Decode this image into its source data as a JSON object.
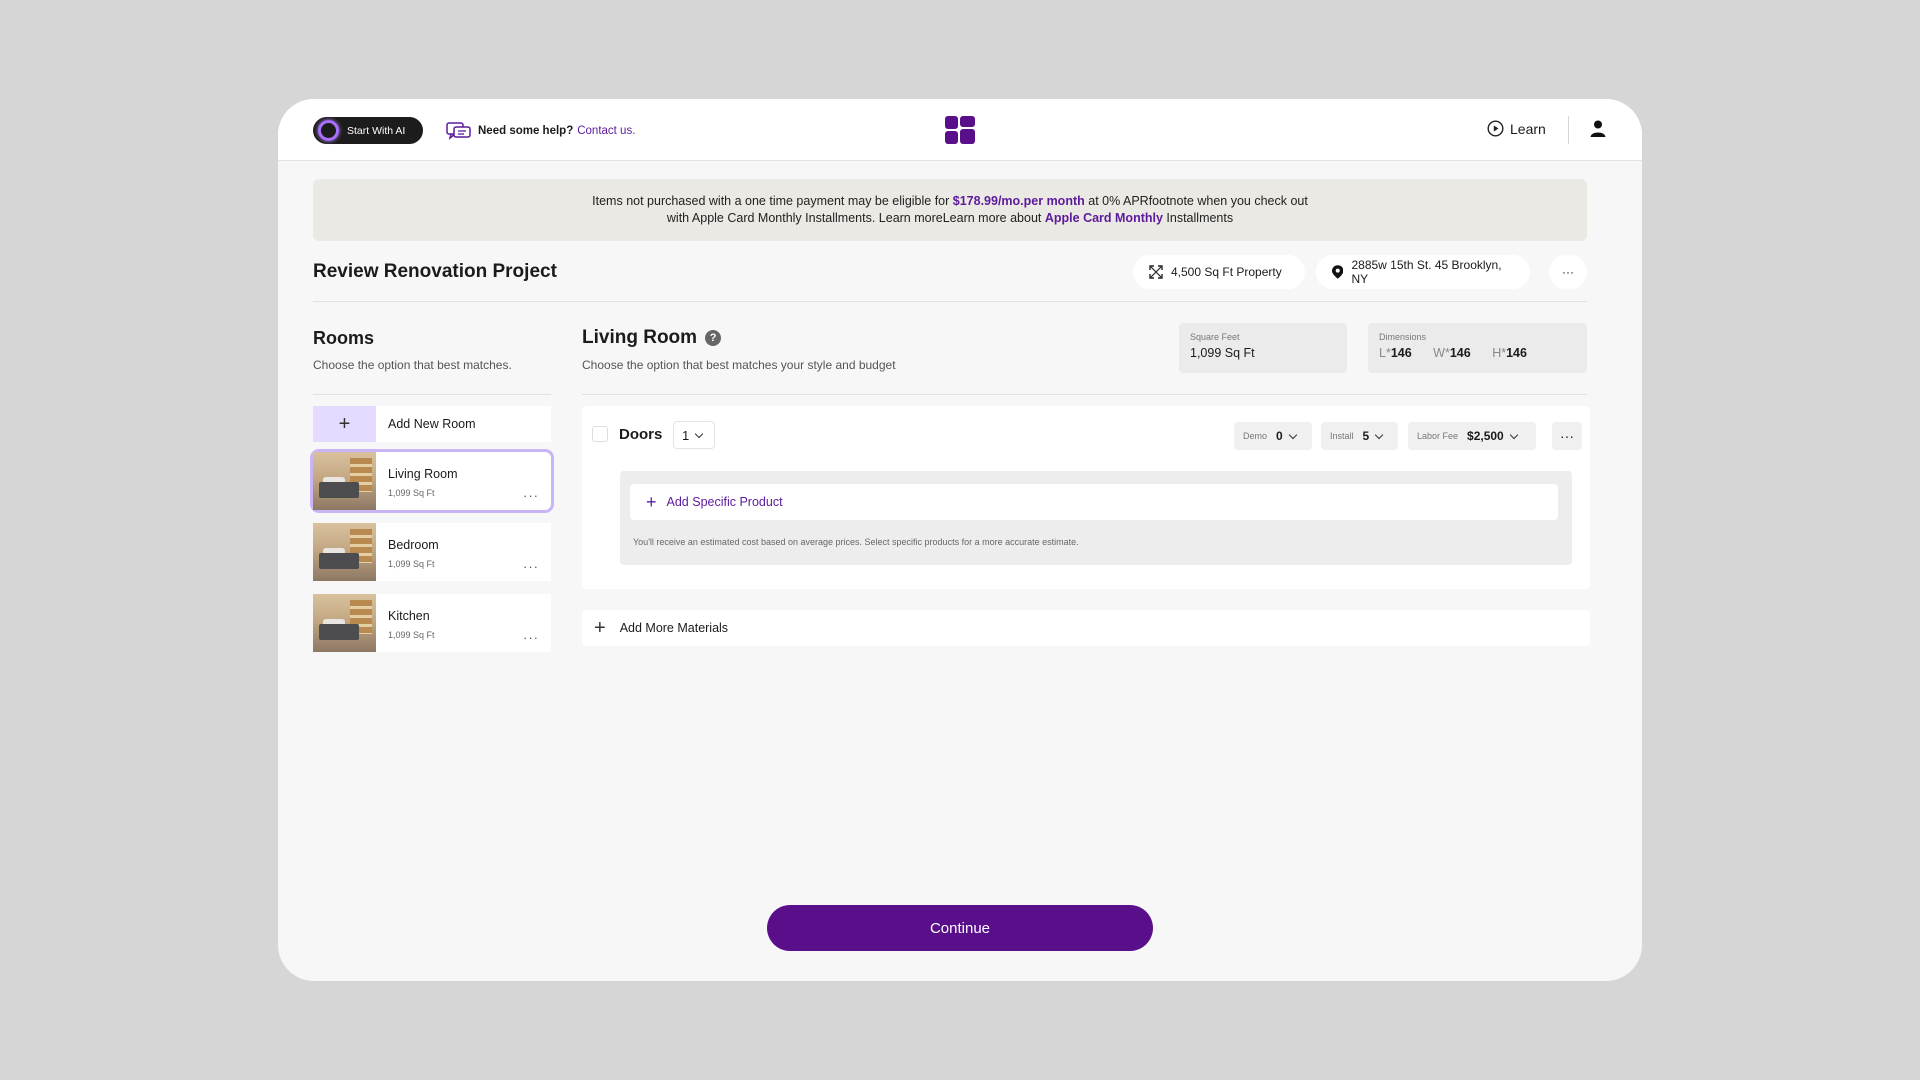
{
  "topbar": {
    "ai_button": "Start With AI",
    "help_text": "Need some help?",
    "help_link": "Contact us.",
    "learn": "Learn"
  },
  "banner": {
    "pre": "Items not purchased with a one time payment may be eligible for ",
    "price": "$178.99/mo.per month",
    "mid": " at 0% APRfootnote when you check out",
    "line2_pre": "with Apple Card Monthly Installments. Learn moreLearn more about ",
    "line2_bold": "Apple Card Monthly",
    "line2_post": " Installments"
  },
  "project": {
    "title": "Review Renovation Project",
    "size": "4,500 Sq Ft Property",
    "address": "2885w 15th St. 45 Brooklyn, NY",
    "more": "···"
  },
  "rooms": {
    "heading": "Rooms",
    "subtitle": "Choose the option that best matches.",
    "add_label": "Add New Room",
    "items": [
      {
        "name": "Living Room",
        "size": "1,099 Sq Ft"
      },
      {
        "name": "Bedroom",
        "size": "1,099 Sq Ft"
      },
      {
        "name": "Kitchen",
        "size": "1,099 Sq Ft"
      }
    ],
    "dots": "···"
  },
  "room_detail": {
    "title": "Living Room",
    "help": "?",
    "subtitle": "Choose the option that best matches your style and budget",
    "sqft_label": "Square Feet",
    "sqft_value": "1,099 Sq Ft",
    "dims_label": "Dimensions",
    "dims": {
      "l_key": "L*",
      "l": "146",
      "w_key": "W*",
      "w": "146",
      "h_key": "H*",
      "h": "146"
    }
  },
  "material": {
    "name": "Doors",
    "qty": "1",
    "demo_label": "Demo",
    "demo_value": "0",
    "install_label": "Install",
    "install_value": "5",
    "labor_label": "Labor Fee",
    "labor_value": "$2,500",
    "more": "···",
    "add_product": "Add Specific Product",
    "note": "You'll receive an estimated cost based on average prices. Select specific products for a more accurate estimate."
  },
  "add_more_materials": "Add More Materials",
  "continue_label": "Continue",
  "colors": {
    "accent": "#5a0f8a",
    "link": "#5b1b9c",
    "add_room_bg": "#e5daff"
  },
  "icons": [
    "ai-ring-icon",
    "chat-icon",
    "logo-icon",
    "play-icon",
    "user-icon",
    "expand-icon",
    "location-pin-icon",
    "plus-icon",
    "chevron-down-icon",
    "more-icon",
    "question-icon"
  ]
}
